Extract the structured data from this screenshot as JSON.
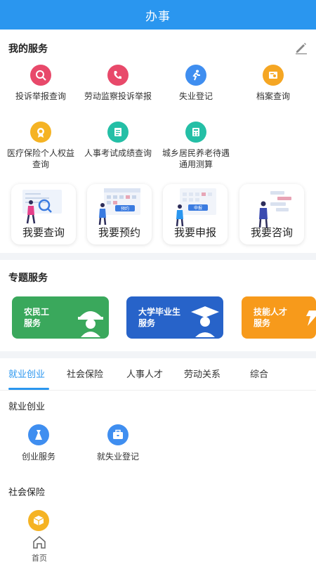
{
  "header": {
    "title": "办事"
  },
  "my_services": {
    "title": "我的服务",
    "items": [
      {
        "label": "投诉举报查询",
        "icon": "search-complaint-icon",
        "color": "#e8496a"
      },
      {
        "label": "劳动监察投诉举报",
        "icon": "phone-icon",
        "color": "#e8496a"
      },
      {
        "label": "失业登记",
        "icon": "runner-icon",
        "color": "#3f8ef0"
      },
      {
        "label": "档案查询",
        "icon": "archive-icon",
        "color": "#f5a623"
      },
      {
        "label": "医疗保险个人权益查询",
        "icon": "medical-badge-icon",
        "color": "#f5b324"
      },
      {
        "label": "人事考试成绩查询",
        "icon": "exam-score-icon",
        "color": "#24bfa6"
      },
      {
        "label": "城乡居民养老待遇通用测算",
        "icon": "pension-calc-icon",
        "color": "#24bfa6"
      }
    ]
  },
  "quick_actions": [
    {
      "label": "我要查询",
      "icon": "query-illustration"
    },
    {
      "label": "我要预约",
      "icon": "appointment-illustration",
      "tag": "预约"
    },
    {
      "label": "我要申报",
      "icon": "declare-illustration",
      "tag": "申报"
    },
    {
      "label": "我要咨询",
      "icon": "consult-illustration"
    }
  ],
  "topic_services": {
    "title": "专题服务",
    "banners": [
      {
        "line1": "农民工",
        "line2": "服务",
        "color": "#3aa85c"
      },
      {
        "line1": "大学毕业生",
        "line2": "服务",
        "color": "#2763c9"
      },
      {
        "line1": "技能人才",
        "line2": "服务",
        "color": "#f79a1b"
      }
    ]
  },
  "tabs": [
    {
      "label": "就业创业",
      "active": true
    },
    {
      "label": "社会保险",
      "active": false
    },
    {
      "label": "人事人才",
      "active": false
    },
    {
      "label": "劳动关系",
      "active": false
    },
    {
      "label": "综合",
      "active": false
    }
  ],
  "employment": {
    "title": "就业创业",
    "items": [
      {
        "label": "创业服务",
        "icon": "startup-icon",
        "color": "#3f8ef0"
      },
      {
        "label": "就失业登记",
        "icon": "briefcase-icon",
        "color": "#3f8ef0"
      }
    ]
  },
  "social_insurance": {
    "title": "社会保险",
    "items": [
      {
        "icon": "cube-icon",
        "color": "#f5b324"
      }
    ]
  },
  "bottom_nav": {
    "home_label": "首页"
  }
}
